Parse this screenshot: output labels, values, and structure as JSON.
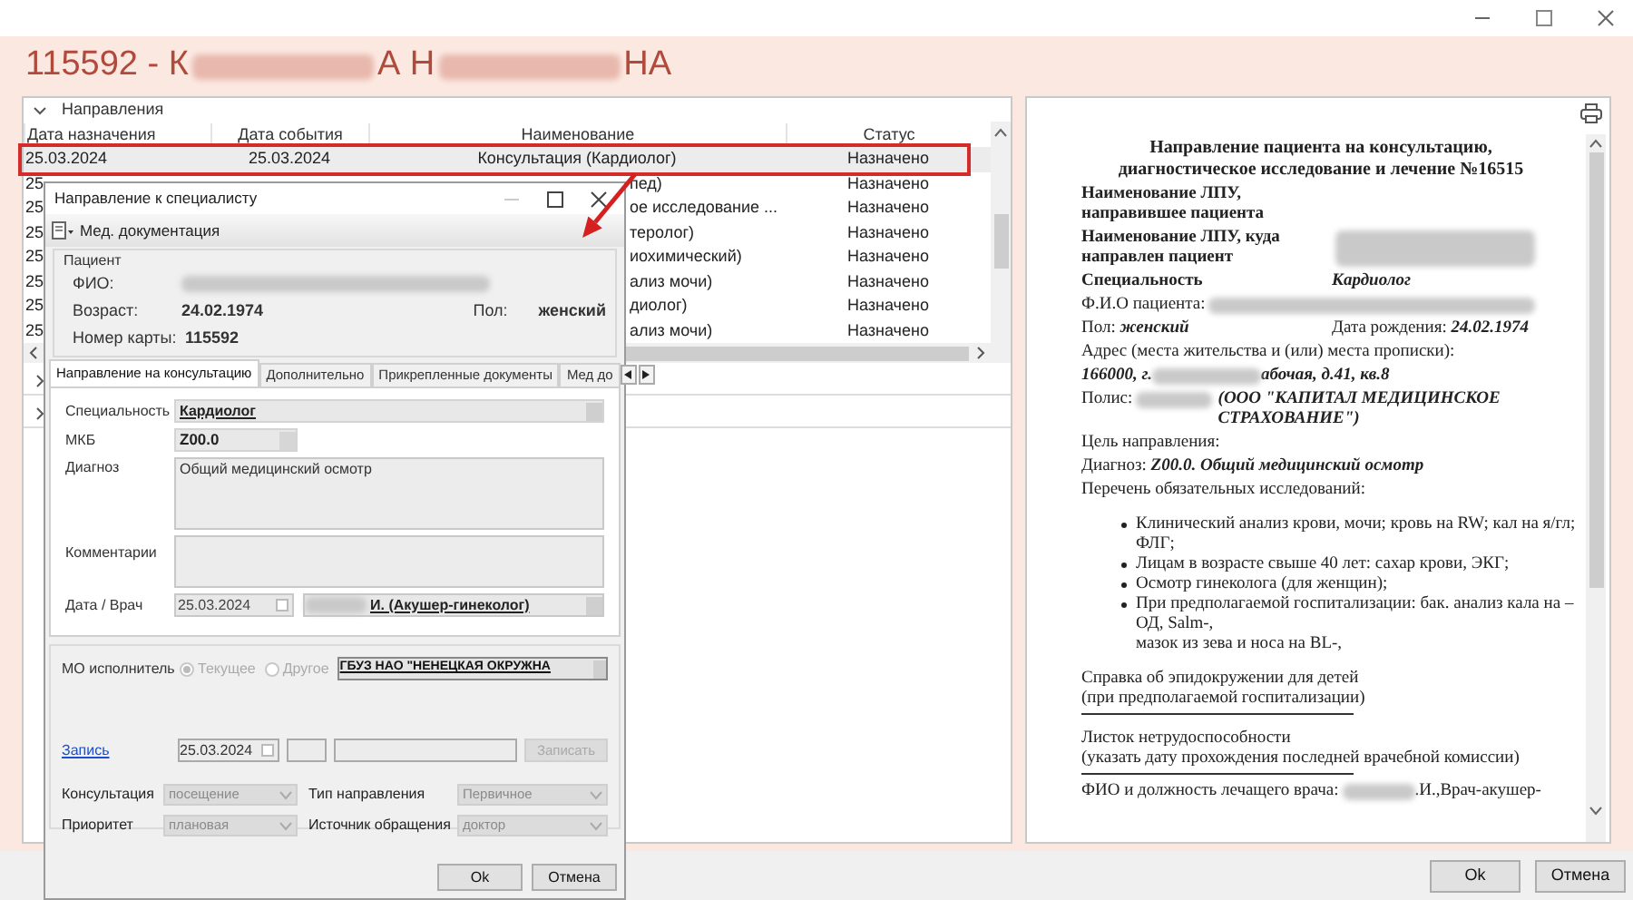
{
  "header": {
    "title_segments": [
      {
        "kind": "text",
        "text": "115592 - К"
      },
      {
        "kind": "redacted"
      },
      {
        "kind": "text",
        "text": "А Н"
      },
      {
        "kind": "redacted"
      },
      {
        "kind": "text",
        "text": "НА"
      }
    ]
  },
  "directions": {
    "group_label": "Направления",
    "expanded": true,
    "columns": [
      "Дата назначения",
      "Дата события",
      "Наименование",
      "Статус"
    ],
    "rows": [
      {
        "kind": "full",
        "date_assigned": "25.03.2024",
        "date_event": "25.03.2024",
        "name": "Консультация (Кардиолог)",
        "status": "Назначено",
        "selected": true
      },
      {
        "kind": "covered",
        "date_assigned": "25",
        "name": "пед)",
        "status": "Назначено",
        "selected": false
      },
      {
        "kind": "covered",
        "date_assigned": "25",
        "name": "ое исследование ...",
        "status": "Назначено",
        "selected": false
      },
      {
        "kind": "covered",
        "date_assigned": "25",
        "name": "теролог)",
        "status": "Назначено",
        "selected": false
      },
      {
        "kind": "covered",
        "date_assigned": "25",
        "name": "иохимический)",
        "status": "Назначено",
        "selected": false
      },
      {
        "kind": "covered",
        "date_assigned": "25",
        "name": "ализ мочи)",
        "status": "Назначено",
        "selected": false
      },
      {
        "kind": "covered",
        "date_assigned": "25",
        "name": "диолог)",
        "status": "Назначено",
        "selected": false
      },
      {
        "kind": "covered",
        "date_assigned": "25",
        "name": "ализ мочи)",
        "status": "Назначено",
        "selected": false
      }
    ],
    "collapsed_groups": [
      {
        "expanded": false
      },
      {
        "expanded": false
      }
    ]
  },
  "dialog": {
    "title": "Направление к специалисту",
    "toolbar_label": "Мед. документация",
    "patient": {
      "group_label": "Пациент",
      "fio_label": "ФИО:",
      "age_label": "Возраст:",
      "age": "24.02.1974",
      "sex_label": "Пол:",
      "sex": "женский",
      "card_label": "Номер карты:",
      "card": "115592"
    },
    "tabs": [
      {
        "label": "Направление на консультацию",
        "selected": true
      },
      {
        "label": "Дополнительно",
        "selected": false
      },
      {
        "label": "Прикрепленные документы",
        "selected": false
      },
      {
        "label": "Мед до",
        "selected": false
      }
    ],
    "specialty_label": "Специальность",
    "specialty": "Кардиолог",
    "mkb_label": "МКБ",
    "mkb": "Z00.0",
    "diagnosis_label": "Диагноз",
    "diagnosis": "Общий медицинский осмотр",
    "comments_label": "Комментарии",
    "date_doctor_label": "Дата / Врач",
    "date": "25.03.2024",
    "date_checked": false,
    "doctor": "И. (Акушер-гинеколог)",
    "mo_label": "МО исполнитель",
    "mo_options": [
      {
        "label": "Текущее",
        "selected": true,
        "disabled": true
      },
      {
        "label": "Другое",
        "selected": false,
        "disabled": true
      }
    ],
    "mo_org": "ГБУЗ НАО \"НЕНЕЦКАЯ ОКРУЖНА",
    "record_link": "Запись",
    "record_date": "25.03.2024",
    "record_date_checked": false,
    "record_button": {
      "label": "Записать",
      "disabled": true
    },
    "combos": [
      {
        "label": "Консультация",
        "value": "посещение"
      },
      {
        "label": "Тип направления",
        "value": "Первичное"
      },
      {
        "label": "Приоритет",
        "value": "плановая"
      },
      {
        "label": "Источник обращения",
        "value": "доктор"
      }
    ],
    "buttons": [
      "Ok",
      "Отмена"
    ]
  },
  "document": {
    "title_lines": [
      "Направление пациента на консультацию,",
      "диагностическое исследование и лечение №16515"
    ],
    "lpu_from_label": "Наименование ЛПУ, направившее пациента",
    "lpu_to_label": "Наименование ЛПУ, куда направлен пациент",
    "specialty_label": "Специальность",
    "specialty": "Кардиолог",
    "fio_label": "Ф.И.О пациента:",
    "sex_label": "Пол:",
    "sex": "женский",
    "birth_label": "Дата рождения:",
    "birth": "24.02.1974",
    "address_label": "Адрес (места жительства и (или) места прописки):",
    "address_start": "166000, г.",
    "address_end": "абочая, д.41, кв.8",
    "policy_label": "Полис:",
    "policy_company": "(ООО \"КАПИТАЛ МЕДИЦИНСКОЕ СТРАХОВАНИЕ\")",
    "purpose_label": "Цель направления:",
    "diagnosis_label": "Диагноз:",
    "diagnosis": "Z00.0. Общий медицинский осмотр",
    "exams_label": "Перечень обязательных исследований:",
    "exams": [
      "Клинический анализ крови, мочи; кровь на RW; кал на я/гл; ФЛГ;",
      "Лицам в возрасте свыше 40 лет: сахар крови, ЭКГ;",
      "Осмотр гинеколога (для женщин);",
      "При предполагаемой госпитализации: бак. анализ кала на – ОД, Salm-,\nмазок из зева и носа на BL-,"
    ],
    "notes": [
      "Справка об эпидокружении для детей\n(при предполагаемой госпитализации)",
      "Листок нетрудоспособности\n(указать дату прохождения последней врачебной комиссии)"
    ],
    "doctor_label": "ФИО и должность лечащего врача:",
    "doctor_end": ".И.,Врач-акушер-"
  },
  "buttons": [
    "Ok",
    "Отмена"
  ]
}
